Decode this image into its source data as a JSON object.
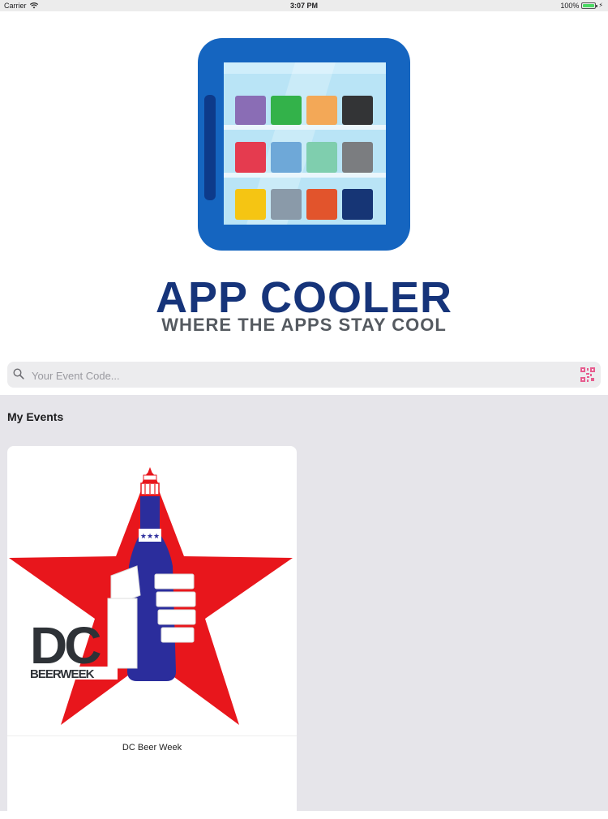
{
  "status_bar": {
    "carrier": "Carrier",
    "time": "3:07 PM",
    "battery_text": "100%",
    "battery_level": 1.0
  },
  "brand": {
    "title": "APP COOLER",
    "tagline": "WHERE THE APPS STAY COOL"
  },
  "search": {
    "placeholder": "Your Event Code...",
    "value": ""
  },
  "events": {
    "section_title": "My Events",
    "items": [
      {
        "name": "DC Beer Week",
        "logo_text_big": "DC",
        "logo_text_small": "BEERWEEK"
      }
    ]
  },
  "colors": {
    "brand_blue": "#1565c0",
    "title_navy": "#16347a",
    "star_red": "#e8161c",
    "bottle_blue": "#2b2d9c",
    "events_bg": "#e6e5ea"
  }
}
